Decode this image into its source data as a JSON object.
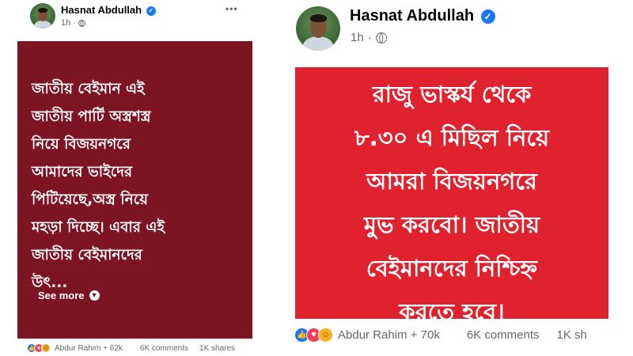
{
  "left_post": {
    "author": "Hasnat Abdullah",
    "time": "1h",
    "more_label": "•••",
    "text_lines": [
      "জাতীয় বেইমান এই",
      "জাতীয় পার্টি অস্ত্রশস্ত্র",
      "নিয়ে বিজয়নগরে",
      "আমাদের ভাইদের",
      "পিটিয়েছে,অস্ত্র নিয়ে",
      "মহড়া দিচ্ছে। এবার এই",
      "জাতীয় বেইমানদের",
      "উৎ..."
    ],
    "see_more": "See more",
    "reactions_summary": "Abdur Rahim + 62k",
    "comments": "6K comments",
    "shares": "1K shares",
    "box_color": "#7d1421"
  },
  "right_post": {
    "author": "Hasnat Abdullah",
    "time": "1h",
    "text_lines": [
      "রাজু ভাস্কর্য থেকে",
      "৮.৩০ এ মিছিল নিয়ে",
      "আমরা বিজয়নগরে",
      "মুভ করবো। জাতীয়",
      "বেইমানদের নিশ্চিহ্ন",
      "করতে হবে।"
    ],
    "reactions_summary": "Abdur Rahim + 70k",
    "comments": "6K comments",
    "shares": "1K sh",
    "box_color": "#e0222f"
  },
  "icons": {
    "verified": "verified-badge-icon",
    "globe": "globe-icon",
    "reactions": [
      "like-icon",
      "love-icon",
      "care-icon",
      "sad-icon"
    ]
  }
}
